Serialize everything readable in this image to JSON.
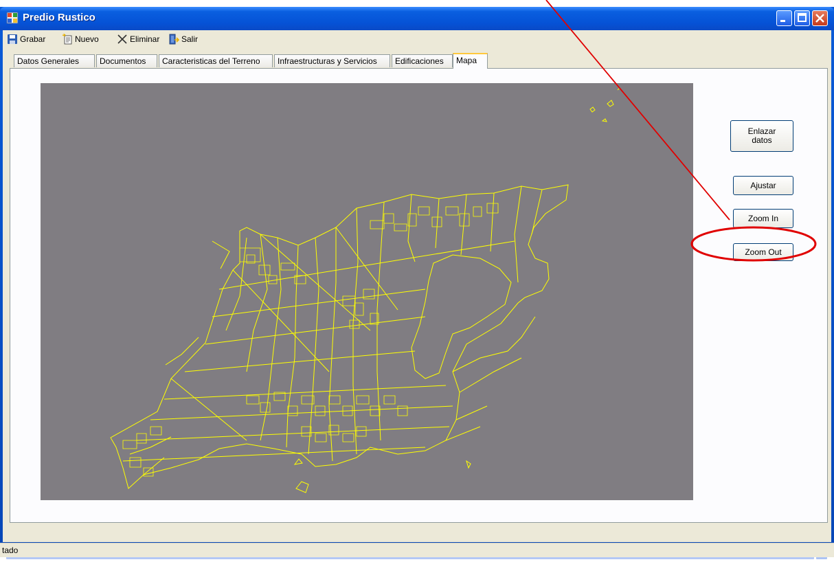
{
  "window": {
    "title": "Predio Rustico"
  },
  "toolbar": {
    "save_label": "Grabar",
    "new_label": "Nuevo",
    "delete_label": "Eliminar",
    "exit_label": "Salir"
  },
  "tabs": [
    {
      "label": "Datos Generales"
    },
    {
      "label": "Documentos"
    },
    {
      "label": "Caracteristicas del Terreno"
    },
    {
      "label": "Infraestructuras y Servicios"
    },
    {
      "label": "Edificaciones"
    },
    {
      "label": "Mapa",
      "active": true
    }
  ],
  "map_panel": {
    "link_data_label": "Enlazar\ndatos",
    "fit_label": "Ajustar",
    "zoom_in_label": "Zoom In",
    "zoom_out_label": "Zoom Out"
  },
  "status": {
    "text": "tado"
  },
  "colors": {
    "map_background": "#807d82",
    "parcel_lines": "#ffff00",
    "annotation": "#e00000"
  },
  "icons": {
    "save": "floppy-disk-icon",
    "new": "new-document-icon",
    "delete": "x-delete-icon",
    "exit": "exit-door-icon",
    "scroll_right": "chevron-right-icon"
  }
}
